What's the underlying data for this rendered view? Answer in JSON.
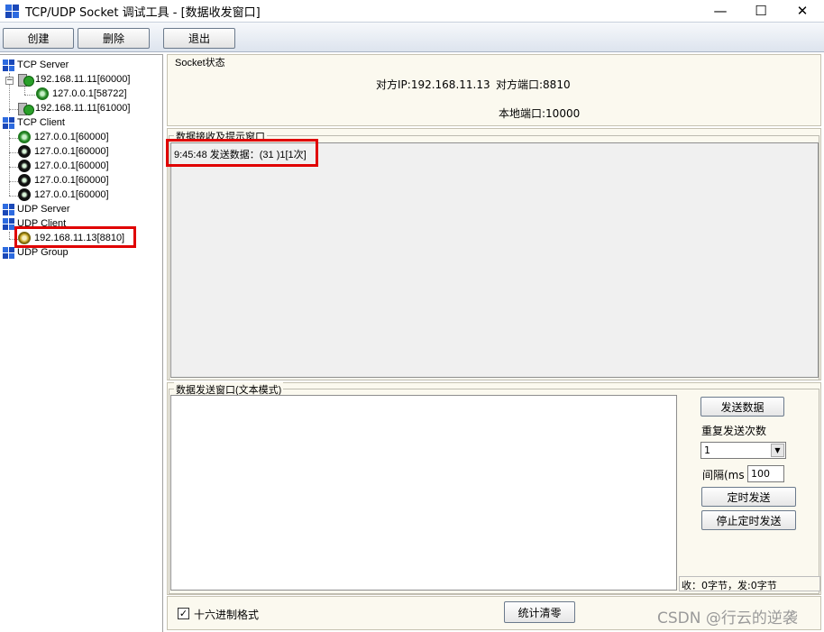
{
  "window": {
    "title": "TCP/UDP Socket 调试工具 - [数据收发窗口]",
    "minimize": "—",
    "maximize": "☐",
    "close": "✕"
  },
  "toolbar": {
    "create_label": "创建",
    "delete_label": "删除",
    "exit_label": "退出"
  },
  "tree": {
    "tcp_server": "TCP Server",
    "tcp_server_items": [
      "192.168.11.11[60000]",
      "127.0.0.1[58722]",
      "192.168.11.11[61000]"
    ],
    "tcp_client": "TCP Client",
    "tcp_client_items": [
      "127.0.0.1[60000]",
      "127.0.0.1[60000]",
      "127.0.0.1[60000]",
      "127.0.0.1[60000]",
      "127.0.0.1[60000]"
    ],
    "udp_server": "UDP Server",
    "udp_client": "UDP Client",
    "udp_client_items": [
      "192.168.11.13[8810]"
    ],
    "udp_group": "UDP Group"
  },
  "socket_status": {
    "group_label": "Socket状态",
    "peer_ip": "对方IP:192.168.11.13",
    "peer_port": "对方端口:8810",
    "local_port": "本地端口:10000"
  },
  "receive": {
    "group_label": "数据接收及提示窗口",
    "log_line": "9:45:48 发送数据：(31 )1[1次]"
  },
  "send": {
    "group_label": "数据发送窗口(文本模式)",
    "send_button": "发送数据",
    "repeat_label": "重复发送次数",
    "repeat_value": "1",
    "interval_label": "间隔(ms",
    "interval_value": "100",
    "timed_send_button": "定时发送",
    "stop_timed_send_button": "停止定时发送",
    "stats": "收：0字节，发:0字节"
  },
  "bottom": {
    "hex_checkbox_checked": true,
    "hex_label": "十六进制格式",
    "clear_stats_button": "统计清零"
  },
  "watermark": "CSDN @行云的逆袭",
  "colors": {
    "highlight": "#e00000",
    "panel_bg": "#fbf9ef",
    "tree_icon_blue": "#2d6be0",
    "connection_green": "#2aa02a"
  }
}
